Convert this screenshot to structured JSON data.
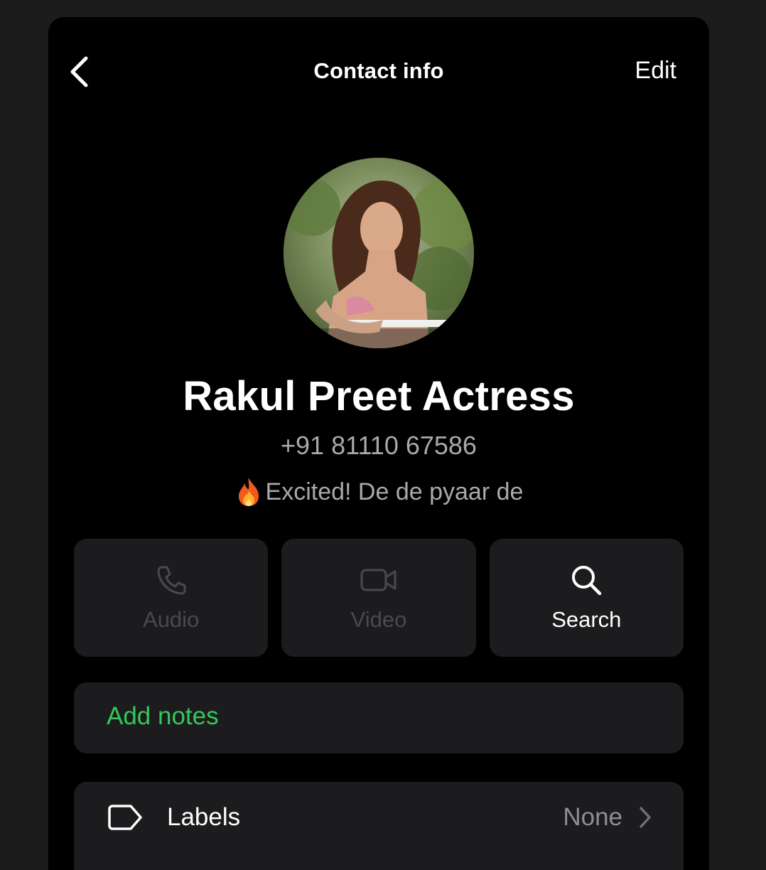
{
  "header": {
    "title": "Contact info",
    "edit_label": "Edit",
    "back_icon": "chevron-left-icon"
  },
  "contact": {
    "name": "Rakul Preet Actress",
    "phone": "+91 81110 67586",
    "status_text": "Excited! De de pyaar de",
    "status_icon": "fire-emoji-icon"
  },
  "actions": [
    {
      "label": "Audio",
      "icon": "phone-icon",
      "enabled": false
    },
    {
      "label": "Video",
      "icon": "video-camera-icon",
      "enabled": false
    },
    {
      "label": "Search",
      "icon": "search-icon",
      "enabled": true
    }
  ],
  "notes": {
    "label": "Add notes"
  },
  "labels_row": {
    "label": "Labels",
    "value": "None",
    "icon": "tag-icon"
  },
  "colors": {
    "background": "#000000",
    "card": "#1c1c1e",
    "accent_green": "#34c759",
    "secondary_text": "#a9a9ad",
    "disabled_text": "#4a4a4d"
  }
}
